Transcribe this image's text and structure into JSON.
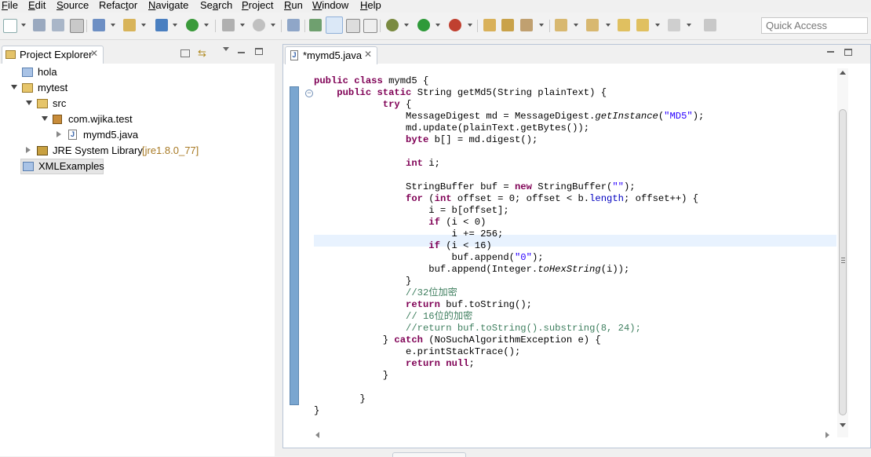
{
  "menu": [
    {
      "pre": "",
      "u": "F",
      "post": "ile"
    },
    {
      "pre": "",
      "u": "E",
      "post": "dit"
    },
    {
      "pre": "",
      "u": "S",
      "post": "ource"
    },
    {
      "pre": "Refac",
      "u": "t",
      "post": "or"
    },
    {
      "pre": "",
      "u": "N",
      "post": "avigate"
    },
    {
      "pre": "Se",
      "u": "a",
      "post": "rch"
    },
    {
      "pre": "",
      "u": "P",
      "post": "roject"
    },
    {
      "pre": "",
      "u": "R",
      "post": "un"
    },
    {
      "pre": "",
      "u": "W",
      "post": "indow"
    },
    {
      "pre": "",
      "u": "H",
      "post": "elp"
    }
  ],
  "quick_access": {
    "placeholder": "Quick Access"
  },
  "project_explorer": {
    "title": "Project Explorer",
    "tree": [
      {
        "label": "hola",
        "icon": "folder-icon",
        "twisty": "none"
      },
      {
        "label": "mytest",
        "icon": "project-open-icon",
        "twisty": "expanded"
      },
      {
        "label": "src",
        "icon": "source-folder-icon",
        "twisty": "expanded"
      },
      {
        "label": "com.wjika.test",
        "icon": "package-icon",
        "twisty": "expanded"
      },
      {
        "label": "mymd5.java",
        "icon": "java-file-icon",
        "twisty": "collapsed"
      },
      {
        "label": "JRE System Library",
        "decor": "[jre1.8.0_77]",
        "icon": "library-icon",
        "twisty": "collapsed"
      },
      {
        "label": "XMLExamples",
        "icon": "folder-icon",
        "twisty": "none"
      }
    ]
  },
  "editor": {
    "tab_label": "*mymd5.java",
    "code": [
      [
        [
          "kw",
          "public"
        ],
        [
          "t",
          " "
        ],
        [
          "kw",
          "class"
        ],
        [
          "t",
          " mymd5 {"
        ]
      ],
      [
        [
          "t",
          "    "
        ],
        [
          "kw",
          "public"
        ],
        [
          "t",
          " "
        ],
        [
          "kw",
          "static"
        ],
        [
          "t",
          " String getMd5(String plainText) {"
        ]
      ],
      [
        [
          "t",
          "            "
        ],
        [
          "kw",
          "try"
        ],
        [
          "t",
          " {"
        ]
      ],
      [
        [
          "t",
          "                MessageDigest md = MessageDigest."
        ],
        [
          "it",
          "getInstance"
        ],
        [
          "t",
          "("
        ],
        [
          "str",
          "\"MD5\""
        ],
        [
          "t",
          ");"
        ]
      ],
      [
        [
          "t",
          "                md.update(plainText.getBytes());"
        ]
      ],
      [
        [
          "t",
          "                "
        ],
        [
          "kw",
          "byte"
        ],
        [
          "t",
          " b[] = md.digest();"
        ]
      ],
      [
        [
          "t",
          ""
        ]
      ],
      [
        [
          "t",
          "                "
        ],
        [
          "kw",
          "int"
        ],
        [
          "t",
          " i;"
        ]
      ],
      [
        [
          "t",
          ""
        ]
      ],
      [
        [
          "t",
          "                StringBuffer buf = "
        ],
        [
          "kw",
          "new"
        ],
        [
          "t",
          " StringBuffer("
        ],
        [
          "str",
          "\"\""
        ],
        [
          "t",
          ");"
        ]
      ],
      [
        [
          "t",
          "                "
        ],
        [
          "kw",
          "for"
        ],
        [
          "t",
          " ("
        ],
        [
          "kw",
          "int"
        ],
        [
          "t",
          " offset = 0; offset < b."
        ],
        [
          "fld",
          "length"
        ],
        [
          "t",
          "; offset++) {"
        ]
      ],
      [
        [
          "t",
          "                    i = b[offset];"
        ]
      ],
      [
        [
          "t",
          "                    "
        ],
        [
          "kw",
          "if"
        ],
        [
          "t",
          " (i < 0)"
        ]
      ],
      [
        [
          "t",
          "                        i += 256;"
        ]
      ],
      [
        [
          "t",
          "                    "
        ],
        [
          "kw",
          "if"
        ],
        [
          "t",
          " (i < 16)"
        ]
      ],
      [
        [
          "t",
          "                        buf.append("
        ],
        [
          "str",
          "\"0\""
        ],
        [
          "t",
          ");"
        ]
      ],
      [
        [
          "t",
          "                    buf.append(Integer."
        ],
        [
          "it",
          "toHexString"
        ],
        [
          "t",
          "(i));"
        ]
      ],
      [
        [
          "t",
          "                }"
        ]
      ],
      [
        [
          "t",
          "                "
        ],
        [
          "cm",
          "//32位加密"
        ]
      ],
      [
        [
          "t",
          "                "
        ],
        [
          "kw",
          "return"
        ],
        [
          "t",
          " buf.toString();"
        ]
      ],
      [
        [
          "t",
          "                "
        ],
        [
          "cm",
          "// 16位的加密"
        ]
      ],
      [
        [
          "t",
          "                "
        ],
        [
          "cm",
          "//return buf.toString().substring(8, 24);"
        ]
      ],
      [
        [
          "t",
          "            } "
        ],
        [
          "kw",
          "catch"
        ],
        [
          "t",
          " (NoSuchAlgorithmException e) {"
        ]
      ],
      [
        [
          "t",
          "                e.printStackTrace();"
        ]
      ],
      [
        [
          "t",
          "                "
        ],
        [
          "kw",
          "return"
        ],
        [
          "t",
          " "
        ],
        [
          "kw",
          "null"
        ],
        [
          "t",
          ";"
        ]
      ],
      [
        [
          "t",
          "            }"
        ]
      ],
      [
        [
          "t",
          ""
        ]
      ],
      [
        [
          "t",
          "        }"
        ]
      ],
      [
        [
          "t",
          "}"
        ]
      ]
    ]
  },
  "colors": {
    "keyword": "#7f0055",
    "string": "#2a00ff",
    "comment": "#3f7f5f",
    "field": "#0000c0",
    "current_line": "#e8f2fe"
  }
}
